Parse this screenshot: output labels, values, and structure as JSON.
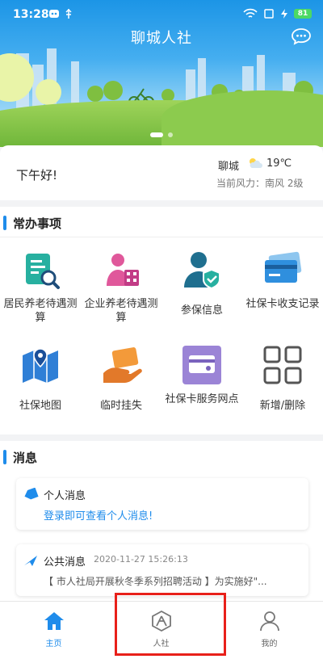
{
  "status_bar": {
    "time": "13:28",
    "battery": "81"
  },
  "header": {
    "title": "聊城人社"
  },
  "greeting": {
    "text": "下午好!",
    "city": "聊城",
    "temperature": "19℃",
    "wind": "当前风力：南风 2级"
  },
  "common_services": {
    "title": "常办事项",
    "items": [
      {
        "label": "居民养老待遇测算",
        "icon": "document-search-icon"
      },
      {
        "label": "企业养老待遇测算",
        "icon": "elder-calculator-icon"
      },
      {
        "label": "参保信息",
        "icon": "user-shield-icon"
      },
      {
        "label": "社保卡收支记录",
        "icon": "card-record-icon"
      },
      {
        "label": "社保地图",
        "icon": "map-pin-icon"
      },
      {
        "label": "临时挂失",
        "icon": "hand-card-icon"
      },
      {
        "label": "社保卡服务网点",
        "icon": "card-outlet-icon"
      },
      {
        "label": "新增/删除",
        "icon": "grid-add-icon"
      }
    ]
  },
  "messages": {
    "title": "消息",
    "personal": {
      "title": "个人消息",
      "content": "登录即可查看个人消息!"
    },
    "public": {
      "title": "公共消息",
      "date": "2020-11-27 15:26:13",
      "content": "【 市人社局开展秋冬季系列招聘活动 】为实施好\"..."
    }
  },
  "tabs": [
    {
      "label": "主页",
      "icon": "home-icon",
      "active": true
    },
    {
      "label": "人社",
      "icon": "renshe-icon",
      "active": false
    },
    {
      "label": "我的",
      "icon": "person-icon",
      "active": false
    }
  ],
  "colors": {
    "accent": "#1f8ceb",
    "highlight": "#e8201a"
  }
}
